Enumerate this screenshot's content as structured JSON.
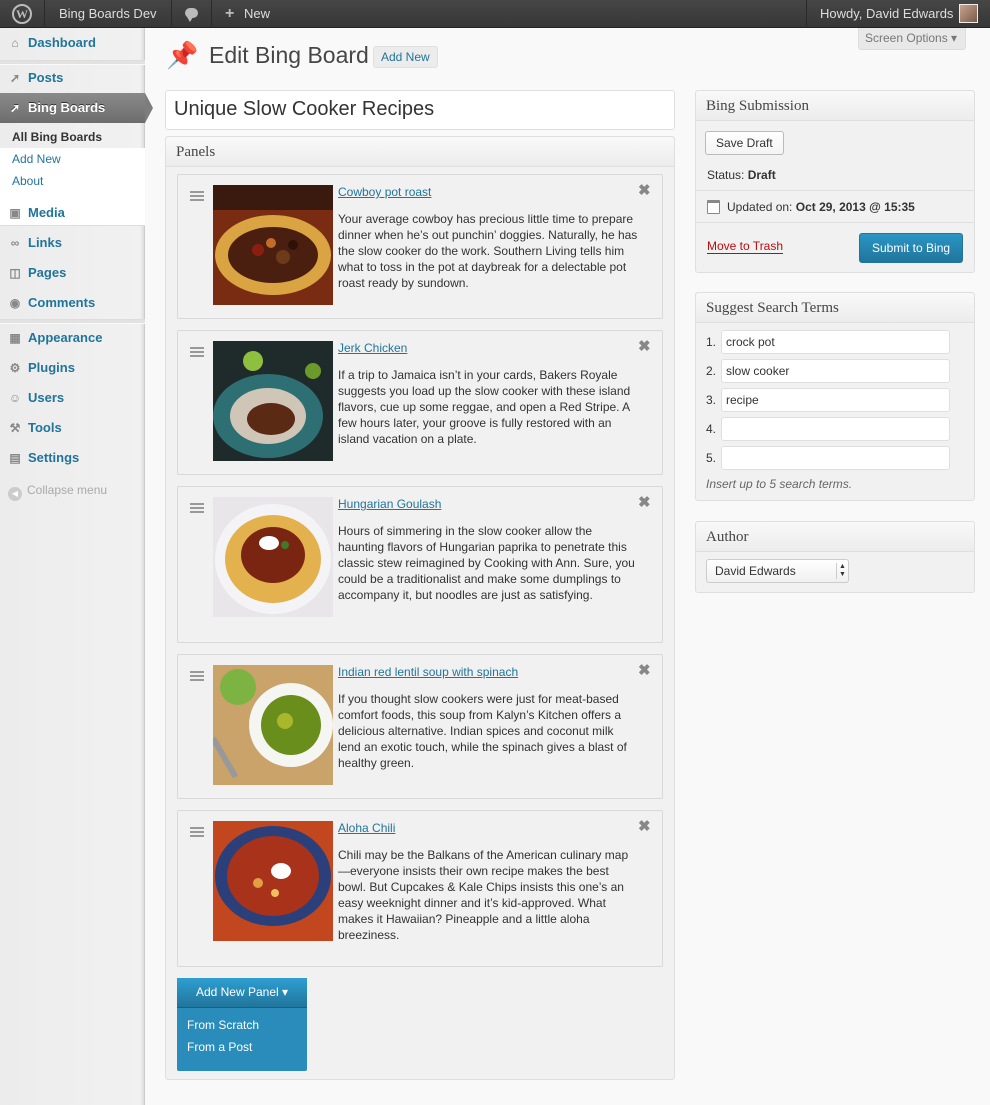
{
  "adminbar": {
    "site_name": "Bing Boards Dev",
    "new_label": "New",
    "howdy": "Howdy, David Edwards",
    "icons": [
      "wordpress-icon",
      "comment-icon",
      "plus-icon"
    ]
  },
  "sidebar": {
    "items": [
      {
        "label": "Dashboard",
        "icon": "dashboard-icon"
      },
      {
        "label": "Posts",
        "icon": "pin-icon"
      },
      {
        "label": "Bing Boards",
        "icon": "pin-icon"
      },
      {
        "label": "Media",
        "icon": "media-icon"
      },
      {
        "label": "Links",
        "icon": "link-icon"
      },
      {
        "label": "Pages",
        "icon": "pages-icon"
      },
      {
        "label": "Comments",
        "icon": "comment-icon"
      },
      {
        "label": "Appearance",
        "icon": "appearance-icon"
      },
      {
        "label": "Plugins",
        "icon": "plugin-icon"
      },
      {
        "label": "Users",
        "icon": "users-icon"
      },
      {
        "label": "Tools",
        "icon": "tools-icon"
      },
      {
        "label": "Settings",
        "icon": "settings-icon"
      }
    ],
    "submenu": [
      "All Bing Boards",
      "Add New",
      "About"
    ],
    "collapse": "Collapse menu"
  },
  "header": {
    "title": "Edit Bing Board",
    "add_new": "Add New",
    "screen_options": "Screen Options ▾"
  },
  "post_title": "Unique Slow Cooker Recipes",
  "panels_box": {
    "title": "Panels",
    "panels": [
      {
        "title": "Cowboy pot roast",
        "description": "Your average cowboy has precious little time to prepare dinner when he’s out punchin’ doggies. Naturally, he has the slow cooker do the work. Southern Living tells him what to toss in the pot at daybreak for a delectable pot roast ready by sundown."
      },
      {
        "title": "Jerk Chicken",
        "description": "If a trip to Jamaica isn’t in your cards, Bakers Royale suggests you load up the slow cooker with these island flavors, cue up some reggae, and open a Red Stripe. A few hours later, your groove is fully restored with an island vacation on a plate."
      },
      {
        "title": "Hungarian Goulash",
        "description": "Hours of simmering in the slow cooker allow the haunting flavors of Hungarian paprika to penetrate this classic stew reimagined by Cooking with Ann. Sure, you could be a traditionalist and make some dumplings to accompany it, but noodles are just as satisfying."
      },
      {
        "title": "Indian red lentil soup with spinach",
        "description": "If you thought slow cookers were just for meat-based comfort foods, this soup from Kalyn’s Kitchen offers a delicious alternative. Indian spices and coconut milk lend an exotic touch, while the spinach gives a blast of healthy green."
      },
      {
        "title": "Aloha Chili",
        "description": "Chili may be the Balkans of the American culinary map—everyone insists their own recipe makes the best bowl. But Cupcakes & Kale Chips insists this one’s an easy weeknight dinner and it’s kid-approved. What makes it Hawaiian? Pineapple and a little aloha breeziness."
      }
    ],
    "add_panel": "Add New Panel ▾",
    "add_options": [
      "From Scratch",
      "From a Post"
    ]
  },
  "submission": {
    "title": "Bing Submission",
    "save_draft": "Save Draft",
    "status_label": "Status:",
    "status_value": "Draft",
    "updated_label": "Updated on:",
    "updated_value": "Oct 29, 2013 @ 15:35",
    "trash": "Move to Trash",
    "submit": "Submit to Bing"
  },
  "search_terms": {
    "title": "Suggest Search Terms",
    "numbers": [
      "1.",
      "2.",
      "3.",
      "4.",
      "5."
    ],
    "values": [
      "crock pot",
      "slow cooker",
      "recipe",
      "",
      ""
    ],
    "hint": "Insert up to 5 search terms."
  },
  "author": {
    "title": "Author",
    "selected": "David Edwards"
  },
  "colors": {
    "link": "#21759b",
    "primary_button": "#21759b",
    "trash": "#bc0b0b"
  }
}
